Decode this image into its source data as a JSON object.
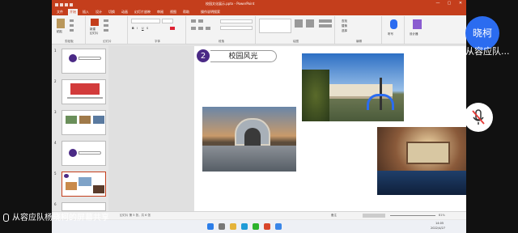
{
  "window": {
    "title": "校园文化展示.pptx - PowerPoint",
    "minimize": "—",
    "maximize": "▢",
    "close": "✕"
  },
  "ribbon_tabs": [
    {
      "label": "文件",
      "active": false
    },
    {
      "label": "开始",
      "active": true
    },
    {
      "label": "插入",
      "active": false
    },
    {
      "label": "设计",
      "active": false
    },
    {
      "label": "切换",
      "active": false
    },
    {
      "label": "动画",
      "active": false
    },
    {
      "label": "幻灯片放映",
      "active": false
    },
    {
      "label": "审阅",
      "active": false
    },
    {
      "label": "视图",
      "active": false
    },
    {
      "label": "帮助",
      "active": false
    },
    {
      "label": "操作说明搜索",
      "active": false
    }
  ],
  "ribbon": {
    "clipboard_label": "剪贴板",
    "paste_label": "粘贴",
    "slides_label": "幻灯片",
    "new_slide_label": "新建\n幻灯片",
    "font_label": "字体",
    "paragraph_label": "段落",
    "drawing_label": "绘图",
    "editing_label": "编辑",
    "find_label": "查找",
    "replace_label": "替换",
    "select_label": "选择",
    "voice_label": "听写",
    "designer_label": "设计器"
  },
  "thumbnails": [
    {
      "number": "1",
      "selected": false
    },
    {
      "number": "2",
      "selected": false
    },
    {
      "number": "3",
      "selected": false
    },
    {
      "number": "4",
      "selected": false
    },
    {
      "number": "5",
      "selected": true
    },
    {
      "number": "6",
      "selected": false
    }
  ],
  "slide": {
    "section_number": "2",
    "section_title": "校园风光"
  },
  "status": {
    "slide_info": "幻灯片 第 5 张，共 6 张",
    "notes_label": "备注",
    "zoom": "81%"
  },
  "taskbar": {
    "time": "14:05",
    "date": "2022/4/27"
  },
  "overlays": {
    "avatar_text": "晓柯",
    "name_tag": "从容应队...",
    "share_caption": "从容应队杨晓柯的屏幕共享"
  },
  "colors": {
    "accent": "#c43e1c",
    "section_badge": "#4b2a86",
    "avatar": "#2b6cf0"
  }
}
